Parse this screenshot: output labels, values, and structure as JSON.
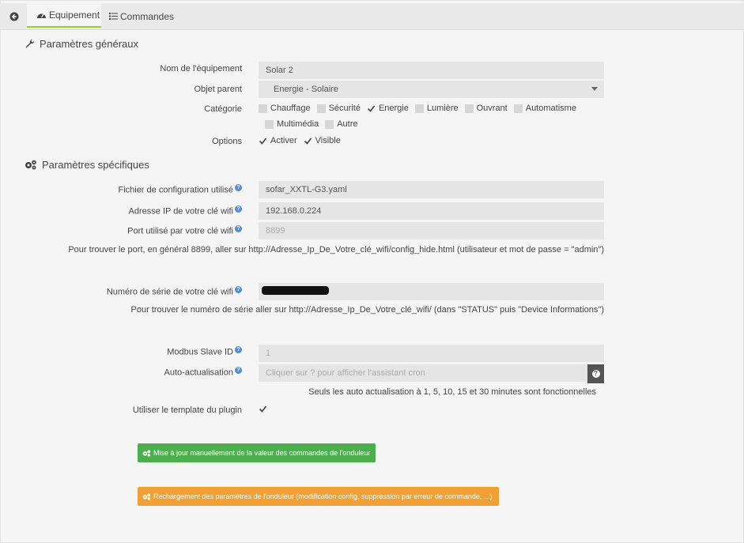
{
  "tabs": {
    "equipement": "Equipement",
    "commandes": "Commandes"
  },
  "general": {
    "title": "Paramètres généraux",
    "name_label": "Nom de l'équipement",
    "name_value": "Solar 2",
    "parent_label": "Objet parent",
    "parent_value": "Energie - Solaire",
    "category_label": "Catégorie",
    "categories": [
      {
        "label": "Chauffage",
        "checked": false
      },
      {
        "label": "Sécurité",
        "checked": false
      },
      {
        "label": "Energie",
        "checked": true
      },
      {
        "label": "Lumière",
        "checked": false
      },
      {
        "label": "Ouvrant",
        "checked": false
      },
      {
        "label": "Automatisme",
        "checked": false
      },
      {
        "label": "Multimédia",
        "checked": false
      },
      {
        "label": "Autre",
        "checked": false
      }
    ],
    "options_label": "Options",
    "options": [
      {
        "label": "Activer",
        "checked": true
      },
      {
        "label": "Visible",
        "checked": true
      }
    ]
  },
  "specific": {
    "title": "Paramètres spécifiques",
    "config_label": "Fichier de configuration utilisé",
    "config_value": "sofar_XXTL-G3.yaml",
    "ip_label": "Adresse IP de votre clé wifi",
    "ip_value": "192.168.0.224",
    "port_label": "Port utilisé par votre clé wifi",
    "port_value": "8899",
    "port_note": "Pour trouver le port, en général 8899, aller sur http://Adresse_Ip_De_Votre_clé_wifi/config_hide.html (utilisateur et mot de passe = \"admin\")",
    "serial_label": "Numéro de série de votre clé wifi",
    "serial_note": "Pour trouver le numéro de série aller sur http://Adresse_Ip_De_Votre_clé_wifi/ (dans \"STATUS\" puis \"Device Informations\")",
    "modbus_label": "Modbus Slave ID",
    "modbus_value": "1",
    "auto_label": "Auto-actualisation",
    "auto_placeholder": "Cliquer sur ? pour afficher l'assistant cron",
    "auto_note": "Seuls les auto actualisation à 1, 5, 10, 15 et 30 minutes sont fonctionnelles",
    "template_label": "Utiliser le template du plugin",
    "template_checked": true
  },
  "buttons": {
    "update": "Mise à jour manuellement de la valeur des commandes de l'onduleur",
    "reload": "Rechargement des paramètres de l'onduleur (modification config, suppression par erreur de commande, ...)"
  },
  "colors": {
    "green": "#4cae4c",
    "orange": "#f0a035",
    "help": "#4f8fd6",
    "tab_active_underline": "#9acd32"
  }
}
